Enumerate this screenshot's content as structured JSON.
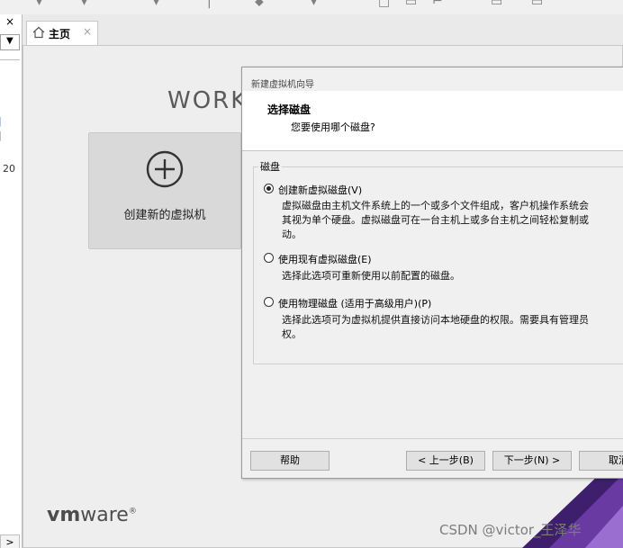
{
  "left_panel": {
    "close_glyph": "×",
    "combo_arrow": "▼",
    "fragment_1": "20",
    "scroll_right": ">"
  },
  "tabs": [
    {
      "label": "主页",
      "close": "×",
      "icon": "home-icon"
    }
  ],
  "home": {
    "wordmark": "WORK",
    "create_vm_label": "创建新的虚拟机",
    "logo_vm": "vm",
    "logo_ware": "ware",
    "logo_mark": "®"
  },
  "wizard": {
    "title": "新建虚拟机向导",
    "heading": "选择磁盘",
    "subheading": "您要使用哪个磁盘?",
    "group_label": "磁盘",
    "options": [
      {
        "label": "创建新虚拟磁盘(V)",
        "checked": true,
        "desc": [
          "虚拟磁盘由主机文件系统上的一个或多个文件组成，客户机操作系统会",
          "其视为单个硬盘。虚拟磁盘可在一台主机上或多台主机之间轻松复制或",
          "动。"
        ]
      },
      {
        "label": "使用现有虚拟磁盘(E)",
        "checked": false,
        "desc": [
          "选择此选项可重新使用以前配置的磁盘。"
        ]
      },
      {
        "label": "使用物理磁盘 (适用于高级用户)(P)",
        "checked": false,
        "desc": [
          "选择此选项可为虚拟机提供直接访问本地硬盘的权限。需要具有管理员",
          "权。"
        ]
      }
    ],
    "buttons": {
      "help": "帮助",
      "back": "< 上一步(B)",
      "next": "下一步(N) >",
      "cancel": "取消"
    }
  },
  "watermark": "CSDN @victor_王泽华",
  "colors": {
    "accent_purple": "#5b2d8e",
    "dialog_bg": "#f0f0f0",
    "content_bg": "#eeeeee"
  }
}
